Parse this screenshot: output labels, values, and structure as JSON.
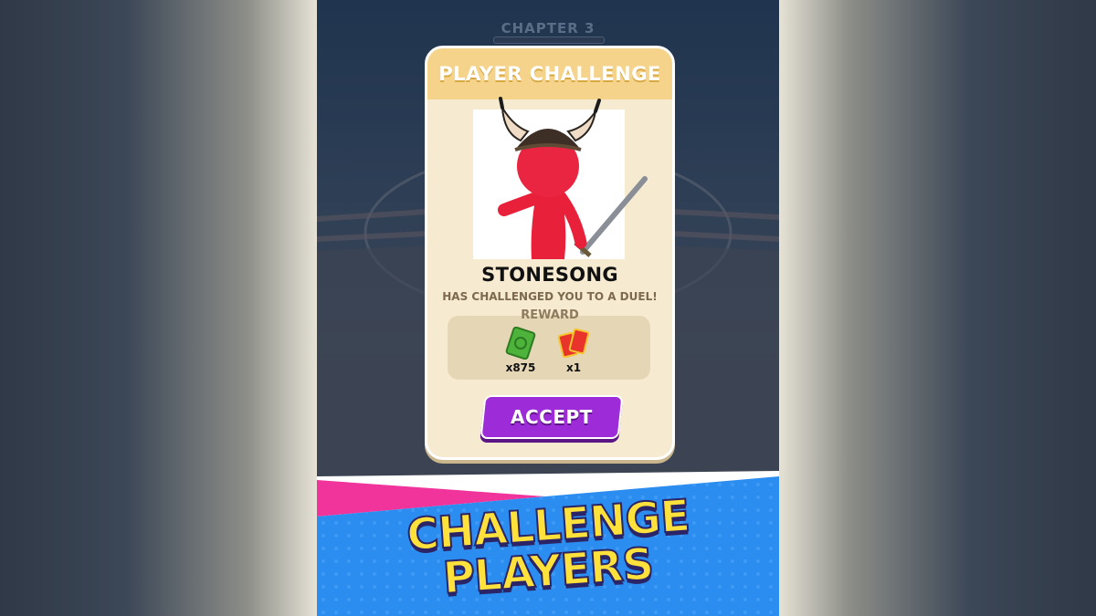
{
  "chapter": "CHAPTER 3",
  "card": {
    "title": "PLAYER CHALLENGE",
    "player_name": "STONESONG",
    "challenge_text": "HAS CHALLENGED YOU TO A DUEL!",
    "reward_label": "REWARD",
    "rewards": [
      {
        "icon": "cash-icon",
        "count": "x875"
      },
      {
        "icon": "ticket-icon",
        "count": "x1"
      }
    ],
    "accept_label": "ACCEPT"
  },
  "banner": {
    "line1": "CHALLENGE",
    "line2": "PLAYERS"
  },
  "colors": {
    "header": "#f5d38a",
    "card_bg": "#f6ead0",
    "accept": "#9d2bd8",
    "banner_blue": "#2b8df0",
    "banner_pink": "#f0349b",
    "banner_text": "#ffe13b",
    "character": "#e8203a"
  }
}
